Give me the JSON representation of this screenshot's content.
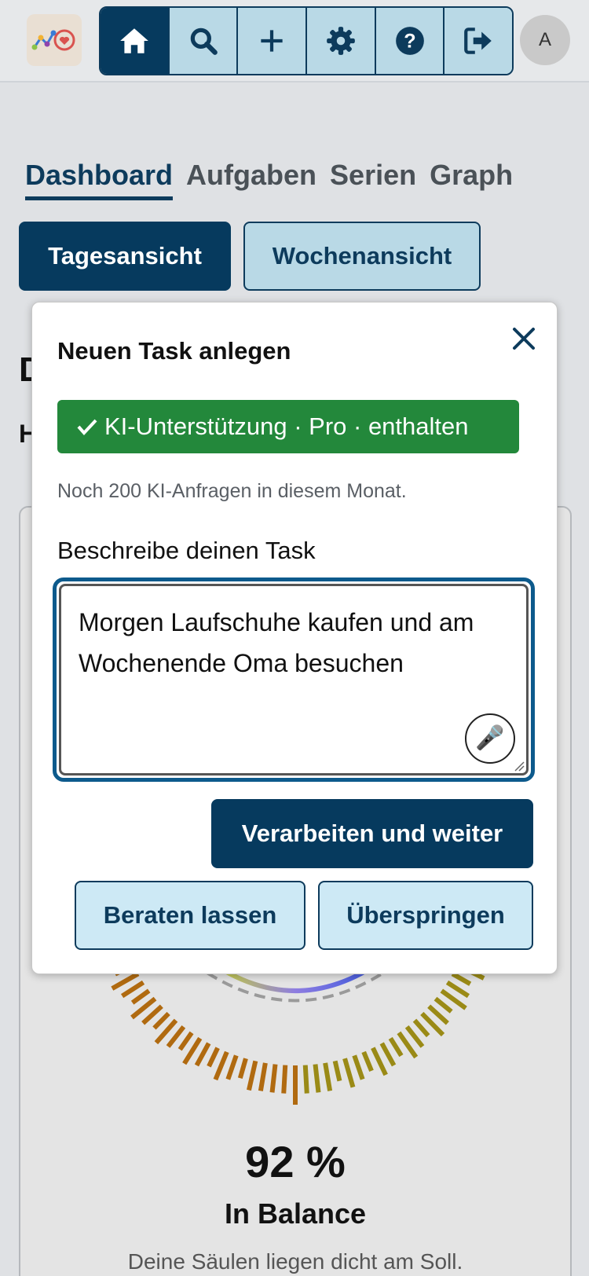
{
  "header": {
    "avatar_initial": "A",
    "nav": [
      {
        "icon": "home-icon",
        "active": true
      },
      {
        "icon": "search-icon",
        "active": false
      },
      {
        "icon": "plus-icon",
        "active": false
      },
      {
        "icon": "gear-icon",
        "active": false
      },
      {
        "icon": "help-icon",
        "active": false
      },
      {
        "icon": "logout-icon",
        "active": false
      }
    ],
    "colors": {
      "nav_active": "#063a5e",
      "nav_inactive": "#b9d9e6"
    }
  },
  "tabs": [
    {
      "label": "Dashboard",
      "active": true
    },
    {
      "label": "Aufgaben",
      "active": false
    },
    {
      "label": "Serien",
      "active": false
    },
    {
      "label": "Graph",
      "active": false
    }
  ],
  "views": {
    "day": "Tagesansicht",
    "week": "Wochenansicht"
  },
  "background": {
    "heading_initial": "D",
    "sub_initial": "H",
    "balance_percent": "92 %",
    "balance_status": "In Balance",
    "balance_desc": "Deine Säulen liegen dicht am Soll."
  },
  "modal": {
    "title": "Neuen Task anlegen",
    "badge": "KI-Unterstützung · Pro · enthalten",
    "quota": "Noch 200 KI-Anfragen in diesem Monat.",
    "field_label": "Beschreibe deinen Task",
    "field_value": "Morgen Laufschuhe kaufen und am Wochenende Oma besuchen",
    "primary_button": "Verarbeiten und weiter",
    "advise_button": "Beraten lassen",
    "skip_button": "Überspringen",
    "colors": {
      "badge": "#23883b",
      "primary": "#063a5e",
      "secondary": "#cde9f5"
    }
  }
}
